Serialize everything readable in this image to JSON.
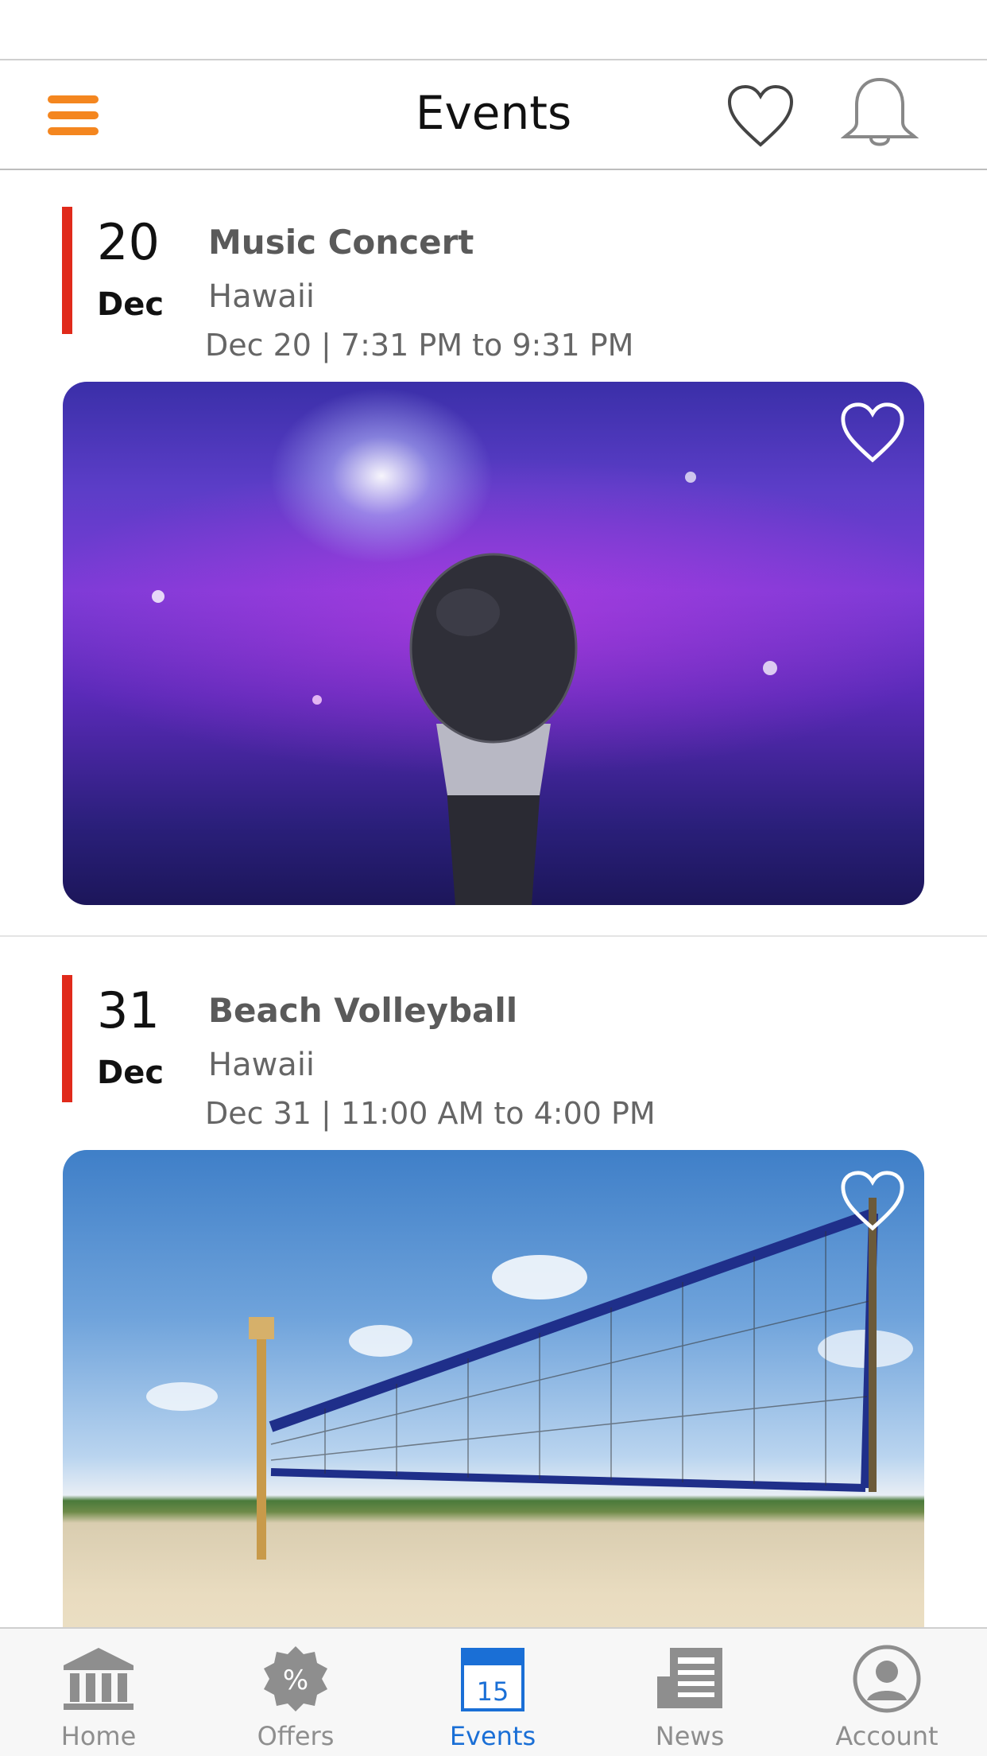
{
  "header": {
    "title": "Events"
  },
  "events": [
    {
      "day": "20",
      "month": "Dec",
      "title": "Music Concert",
      "location": "Hawaii",
      "time": "Dec 20 | 7:31 PM to 9:31 PM",
      "image": "concert-microphone"
    },
    {
      "day": "31",
      "month": "Dec",
      "title": "Beach Volleyball",
      "location": "Hawaii",
      "time": "Dec 31 | 11:00 AM to 4:00 PM",
      "image": "beach-volleyball-net"
    }
  ],
  "tabbar": {
    "tabs": [
      {
        "label": "Home",
        "icon": "bank-icon"
      },
      {
        "label": "Offers",
        "icon": "percent-badge-icon"
      },
      {
        "label": "Events",
        "icon": "calendar-icon",
        "calendar_number": "15",
        "active": true
      },
      {
        "label": "News",
        "icon": "newspaper-icon"
      },
      {
        "label": "Account",
        "icon": "user-icon"
      }
    ]
  },
  "colors": {
    "accent_orange": "#f4861f",
    "date_bar_red": "#e02a1b",
    "active_tab_blue": "#1a6fd6",
    "inactive_gray": "#8e8e8e"
  }
}
